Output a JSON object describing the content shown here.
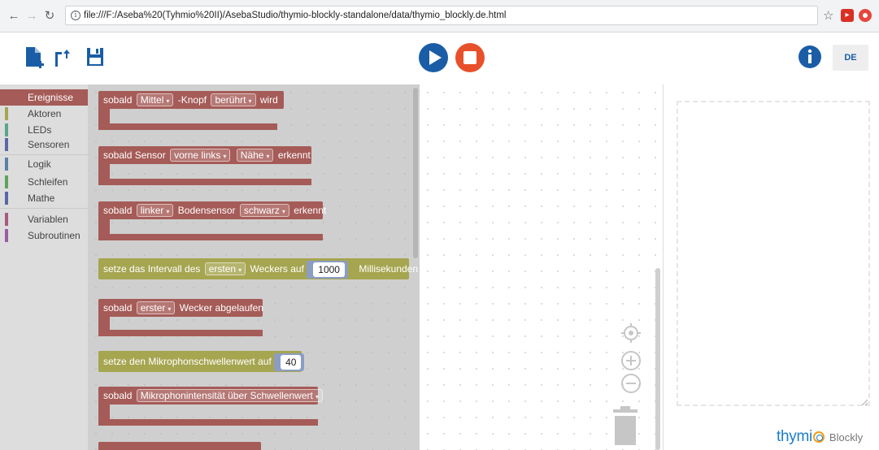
{
  "browser": {
    "url": "file:///F:/Aseba%20(Tyhmio%20II)/AsebaStudio/thymio-blockly-standalone/data/thymio_blockly.de.html",
    "info_glyph": "i"
  },
  "toolbar": {
    "language_button": "DE",
    "icons": [
      "new-file-icon",
      "open-file-icon",
      "save-icon",
      "play-icon",
      "stop-icon",
      "info-icon"
    ],
    "colors": {
      "play": "#1a5da6",
      "stop": "#e8502b",
      "info": "#1a5da6"
    }
  },
  "toolbox": {
    "categories": [
      {
        "label": "Ereignisse",
        "color": "#a55b57",
        "selected": true
      },
      {
        "label": "Aktoren",
        "color": "#a6a550"
      },
      {
        "label": "LEDs",
        "color": "#5ba58c"
      },
      {
        "label": "Sensoren",
        "color": "#5b67a5"
      },
      {
        "label": "Logik",
        "color": "#5b80a5"
      },
      {
        "label": "Schleifen",
        "color": "#5ba55b"
      },
      {
        "label": "Mathe",
        "color": "#5b67a5"
      },
      {
        "label": "Variablen",
        "color": "#a55b80"
      },
      {
        "label": "Subroutinen",
        "color": "#995ba5"
      }
    ]
  },
  "flyout": {
    "b1": {
      "t1": "sobald",
      "d1": "Mittel",
      "t2": "-Knopf",
      "d2": "berührt",
      "t3": "wird"
    },
    "b2": {
      "t1": "sobald Sensor",
      "d1": "vorne links",
      "d2": "Nähe",
      "t2": "erkennt"
    },
    "b3": {
      "t1": "sobald",
      "d1": "linker",
      "t2": "Bodensensor",
      "d2": "schwarz",
      "t3": "erkennt"
    },
    "b4": {
      "t1": "setze das Intervall des",
      "d1": "ersten",
      "t2": "Weckers auf",
      "n1": "1000",
      "t3": "Millisekunden"
    },
    "b5": {
      "t1": "sobald",
      "d1": "erster",
      "t2": "Wecker abgelaufen"
    },
    "b6": {
      "t1": "setze den Mikrophonschwellenwert auf",
      "n1": "40"
    },
    "b7": {
      "t1": "sobald",
      "d1": "Mikrophonintensität über Schwellenwert"
    }
  },
  "brand": {
    "name": "thymi",
    "sub": "Blockly"
  }
}
